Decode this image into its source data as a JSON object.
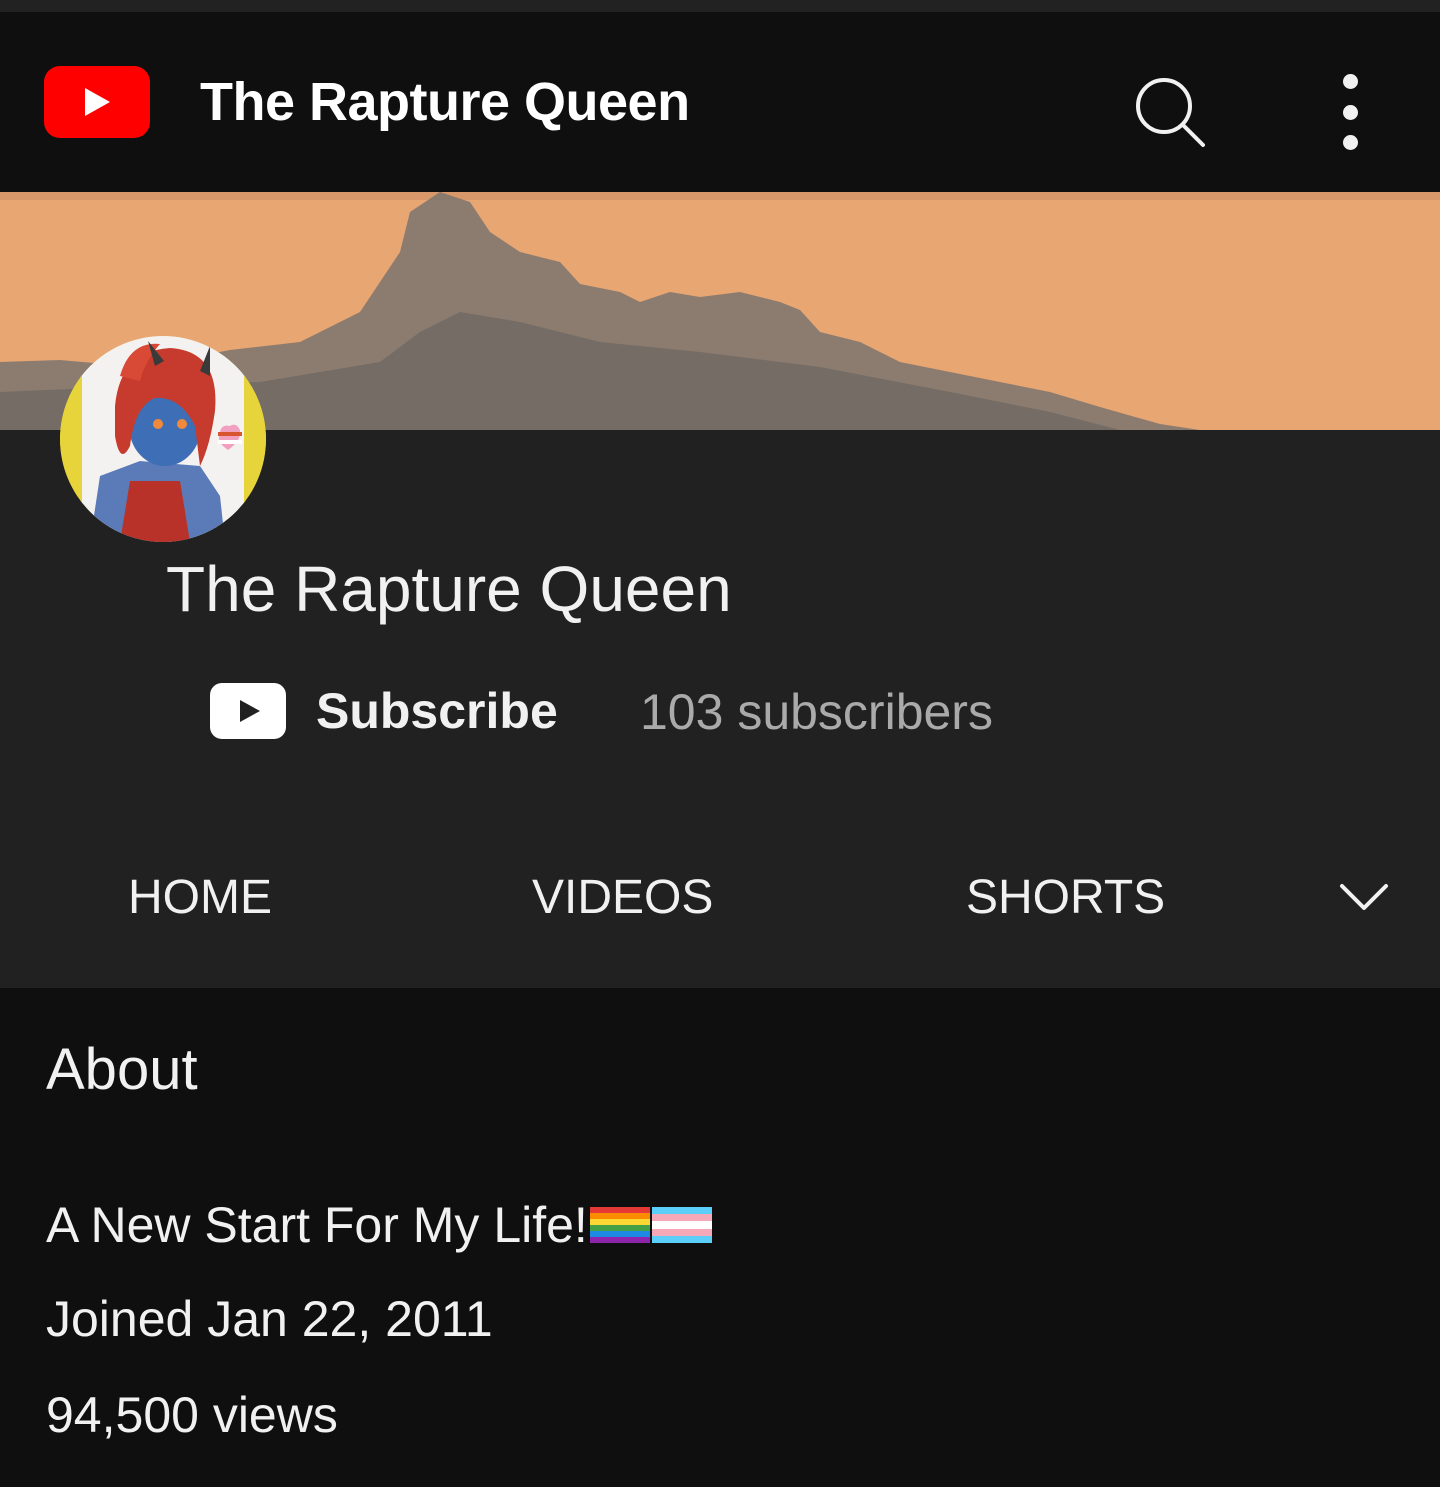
{
  "app_bar": {
    "title": "The Rapture Queen",
    "logo_icon": "youtube-logo-icon",
    "search_icon": "search-icon",
    "more_icon": "more-vertical-icon",
    "brand_color": "#ff0000"
  },
  "channel": {
    "name": "The Rapture Queen",
    "subscribe_label": "Subscribe",
    "subscriber_count": "103 subscribers",
    "avatar_icon": "channel-avatar"
  },
  "tabs": [
    {
      "label": "HOME"
    },
    {
      "label": "VIDEOS"
    },
    {
      "label": "SHORTS"
    }
  ],
  "tabs_expand_icon": "chevron-down-icon",
  "about": {
    "title": "About",
    "description": "A New Start For My Life!",
    "description_emoji": [
      "rainbow-flag",
      "transgender-flag"
    ],
    "joined": "Joined Jan 22, 2011",
    "views": "94,500 views"
  },
  "colors": {
    "background": "#0f0f0f",
    "header_surface": "#212121",
    "text_primary": "#f1f1f1",
    "text_secondary": "#aaaaaa"
  }
}
